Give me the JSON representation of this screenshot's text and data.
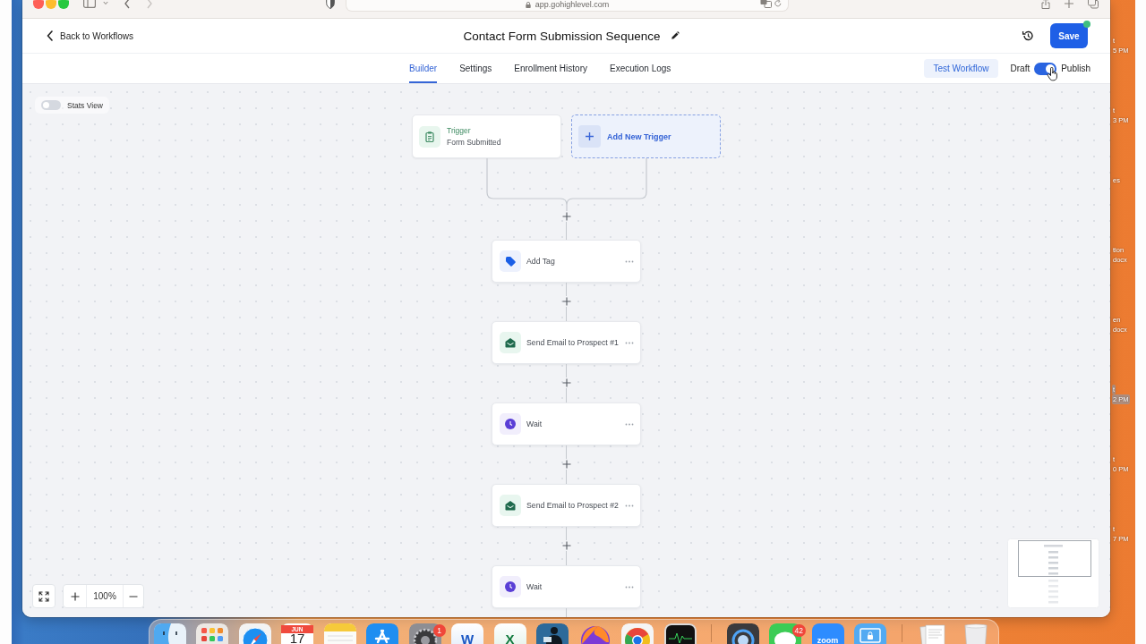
{
  "browser": {
    "url": "app.gohighlevel.com"
  },
  "header": {
    "back_link": "Back to Workflows",
    "title": "Contact Form Submission Sequence",
    "save_button": "Save"
  },
  "tabs": [
    {
      "label": "Builder",
      "selected": true
    },
    {
      "label": "Settings",
      "selected": false
    },
    {
      "label": "Enrollment History",
      "selected": false
    },
    {
      "label": "Execution Logs",
      "selected": false
    }
  ],
  "test_button": "Test Workflow",
  "publish": {
    "draft_label": "Draft",
    "publish_label": "Publish",
    "on": true
  },
  "stats_view": {
    "label": "Stats View",
    "on": false
  },
  "triggers": [
    {
      "title": "Trigger",
      "subtitle": "Form Submitted"
    }
  ],
  "add_trigger": "Add New Trigger",
  "actions": [
    {
      "kind": "tag",
      "label": "Add Tag"
    },
    {
      "kind": "email",
      "label": "Send Email to Prospect #1"
    },
    {
      "kind": "wait",
      "label": "Wait"
    },
    {
      "kind": "email",
      "label": "Send Email to Prospect #2"
    },
    {
      "kind": "wait",
      "label": "Wait"
    }
  ],
  "zoom_level": "100%",
  "desktop_icons": [
    {
      "lines": [
        "t",
        "5 PM"
      ],
      "selected": false
    },
    {
      "lines": [
        "t",
        "3 PM"
      ],
      "selected": false
    },
    {
      "lines": [
        "es"
      ],
      "selected": false
    },
    {
      "lines": [
        "tion",
        "docx"
      ],
      "selected": false
    },
    {
      "lines": [
        "en",
        "docx"
      ],
      "selected": false
    },
    {
      "lines": [
        "t",
        "2 PM"
      ],
      "selected": true
    },
    {
      "lines": [
        "t",
        "0 PM"
      ],
      "selected": false
    },
    {
      "lines": [
        "t",
        "7 PM"
      ],
      "selected": false
    }
  ],
  "dock": {
    "items": [
      {
        "kind": "finder"
      },
      {
        "kind": "launchpad"
      },
      {
        "kind": "safari"
      },
      {
        "kind": "calendar",
        "month": "JUN",
        "day": "17"
      },
      {
        "kind": "notes"
      },
      {
        "kind": "appstore"
      },
      {
        "kind": "settings",
        "badge": "1"
      },
      {
        "kind": "word",
        "logo_text": "W"
      },
      {
        "kind": "excel",
        "logo_text": "X"
      },
      {
        "kind": "reader"
      },
      {
        "kind": "firefox"
      },
      {
        "kind": "chrome"
      },
      {
        "kind": "monitor"
      },
      {
        "kind": "separator"
      },
      {
        "kind": "quicktime"
      },
      {
        "kind": "messages",
        "badge": "42"
      },
      {
        "kind": "zoom",
        "logo_text": "zoom"
      },
      {
        "kind": "remote"
      },
      {
        "kind": "separator"
      },
      {
        "kind": "documents"
      },
      {
        "kind": "trash"
      }
    ]
  }
}
